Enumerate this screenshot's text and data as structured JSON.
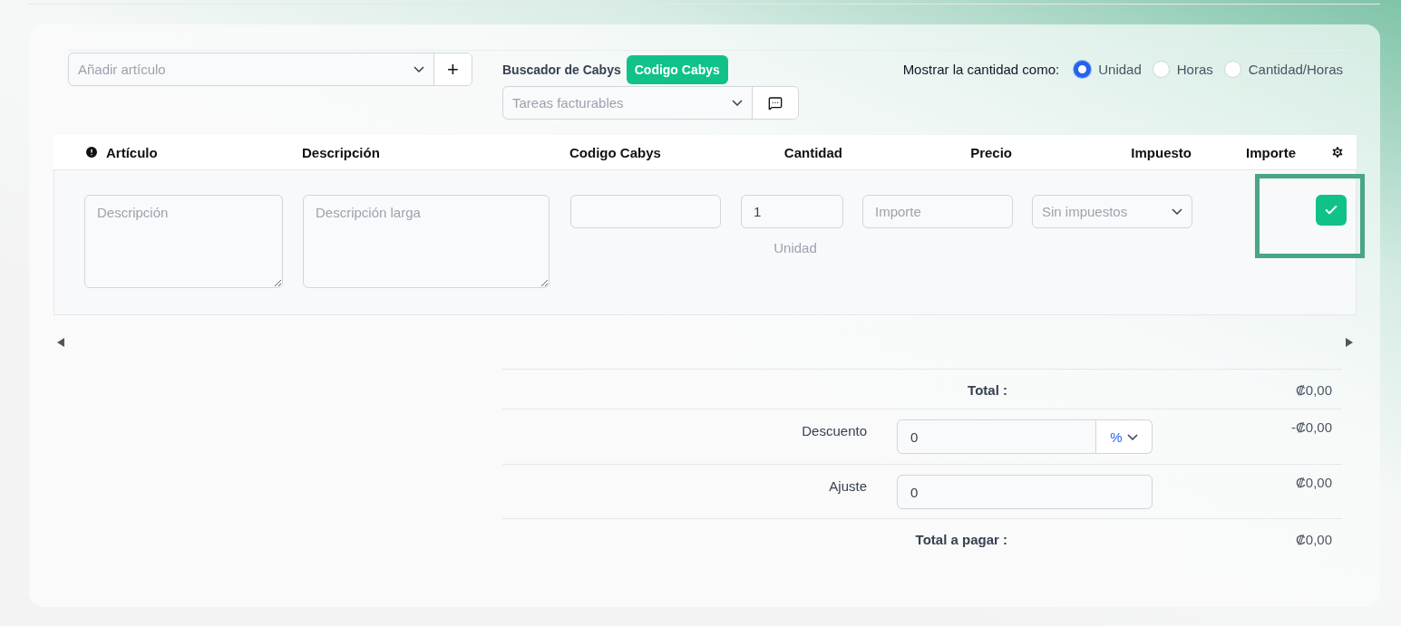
{
  "item_search": {
    "placeholder": "Añadir artículo",
    "add": "+"
  },
  "cabys": {
    "label": "Buscador de Cabys",
    "badge": "Codigo Cabys",
    "placeholder": "Tareas facturables"
  },
  "quantity_mode": {
    "label": "Mostrar la cantidad como:",
    "options": [
      {
        "label": "Unidad",
        "selected": true
      },
      {
        "label": "Horas",
        "selected": false
      },
      {
        "label": "Cantidad/Horas",
        "selected": false
      }
    ]
  },
  "table": {
    "columns": [
      {
        "label": "Artículo"
      },
      {
        "label": "Descripción"
      },
      {
        "label": "Codigo Cabys"
      },
      {
        "label": "Cantidad"
      },
      {
        "label": "Precio"
      },
      {
        "label": "Impuesto"
      },
      {
        "label": "Importe"
      }
    ],
    "row": {
      "description_placeholder": "Descripción",
      "long_description_placeholder": "Descripción larga",
      "quantity": "1",
      "unit": "Unidad",
      "price_placeholder": "Importe",
      "tax": "Sin impuestos",
      "highlighted": true
    }
  },
  "totals": {
    "total_label": "Total :",
    "total": "₡0,00",
    "discount_label": "Descuento",
    "discount": "0",
    "discount_type": "%",
    "discount_amount": "-₡0,00",
    "adjustment_label": "Ajuste",
    "adjustment": "0",
    "adjustment_amount": "₡0,00",
    "payable_label": "Total a pagar :",
    "payable": "₡0,00"
  }
}
